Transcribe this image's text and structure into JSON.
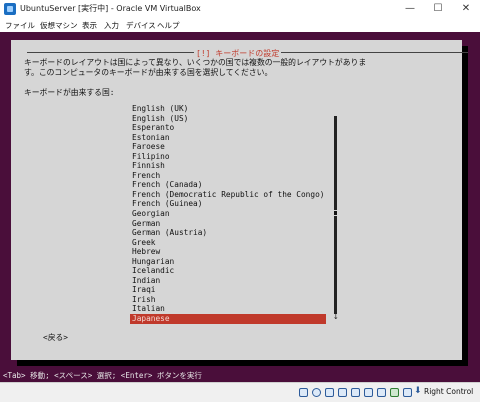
{
  "window": {
    "title": "UbuntuServer [実行中] - Oracle VM VirtualBox",
    "minimize": "—",
    "maximize": "☐",
    "close": "✕"
  },
  "menubar": [
    "ファイル",
    "仮想マシン",
    "表示",
    "入力",
    "デバイス",
    "ヘルプ"
  ],
  "dialog": {
    "title": "[!] キーボードの設定",
    "description_line1": "キーボードのレイアウトは国によって異なり、いくつかの国では複数の一般的レイアウトがありま",
    "description_line2": "す。このコンピュータのキーボードが由来する国を選択してください。",
    "prompt": "キーボードが由来する国:",
    "options": [
      "English (UK)",
      "English (US)",
      "Esperanto",
      "Estonian",
      "Faroese",
      "Filipino",
      "Finnish",
      "French",
      "French (Canada)",
      "French (Democratic Republic of the Congo)",
      "French (Guinea)",
      "Georgian",
      "German",
      "German (Austria)",
      "Greek",
      "Hebrew",
      "Hungarian",
      "Icelandic",
      "Indian",
      "Iraqi",
      "Irish",
      "Italian",
      "Japanese"
    ],
    "selected": "Japanese",
    "scroll_down_arrow": "↓",
    "back_button": "<戻る>"
  },
  "help_bar": "<Tab> 移動; <スペース> 選択; <Enter> ボタンを実行",
  "statusbar": {
    "host_key_label": "Right Control",
    "icons": [
      "disk-icon",
      "optical-drive-icon",
      "audio-icon",
      "network-icon",
      "usb-icon",
      "shared-folder-icon",
      "display-icon",
      "video-capture-icon",
      "cpu-icon",
      "arrow-down-icon"
    ]
  },
  "colors": {
    "background": "#4a0e3a",
    "dialog": "#d6d6d6",
    "highlight": "#c0392b"
  }
}
